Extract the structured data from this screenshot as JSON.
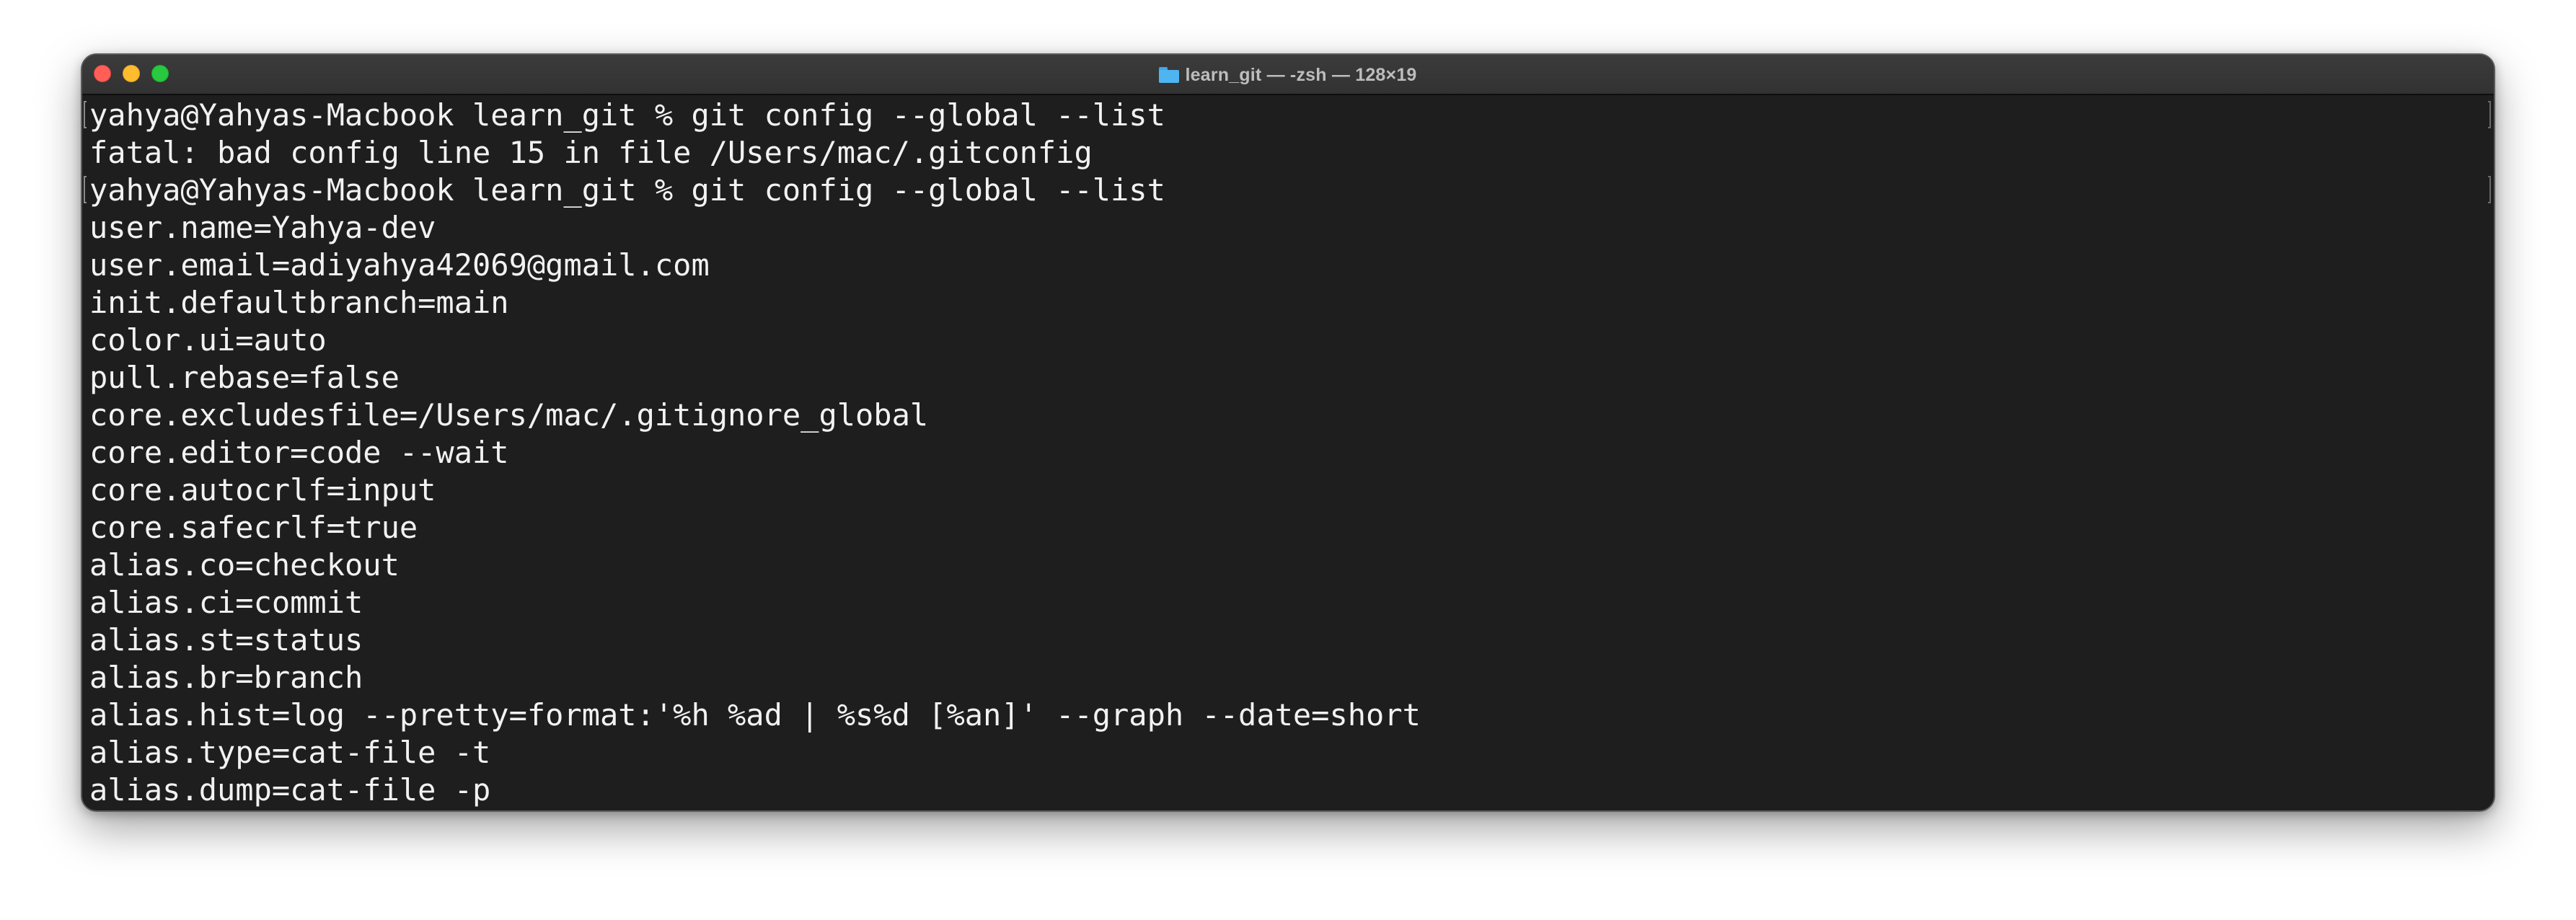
{
  "window": {
    "title": "learn_git — -zsh — 128×19",
    "title_icon": "folder-icon"
  },
  "terminal": {
    "lines": [
      {
        "text": "yahya@Yahyas-Macbook learn_git % git config --global --list",
        "prompt": true
      },
      {
        "text": "fatal: bad config line 15 in file /Users/mac/.gitconfig",
        "prompt": false
      },
      {
        "text": "yahya@Yahyas-Macbook learn_git % git config --global --list",
        "prompt": true
      },
      {
        "text": "user.name=Yahya-dev",
        "prompt": false
      },
      {
        "text": "user.email=adiyahya42069@gmail.com",
        "prompt": false
      },
      {
        "text": "init.defaultbranch=main",
        "prompt": false
      },
      {
        "text": "color.ui=auto",
        "prompt": false
      },
      {
        "text": "pull.rebase=false",
        "prompt": false
      },
      {
        "text": "core.excludesfile=/Users/mac/.gitignore_global",
        "prompt": false
      },
      {
        "text": "core.editor=code --wait",
        "prompt": false
      },
      {
        "text": "core.autocrlf=input",
        "prompt": false
      },
      {
        "text": "core.safecrlf=true",
        "prompt": false
      },
      {
        "text": "alias.co=checkout",
        "prompt": false
      },
      {
        "text": "alias.ci=commit",
        "prompt": false
      },
      {
        "text": "alias.st=status",
        "prompt": false
      },
      {
        "text": "alias.br=branch",
        "prompt": false
      },
      {
        "text": "alias.hist=log --pretty=format:'%h %ad | %s%d [%an]' --graph --date=short",
        "prompt": false
      },
      {
        "text": "alias.type=cat-file -t",
        "prompt": false
      },
      {
        "text": "alias.dump=cat-file -p",
        "prompt": false
      }
    ]
  },
  "colors": {
    "background": "#1e1e1e",
    "foreground": "#f2f2f2",
    "close": "#ff5f57",
    "minimize": "#febc2e",
    "maximize": "#28c840"
  }
}
